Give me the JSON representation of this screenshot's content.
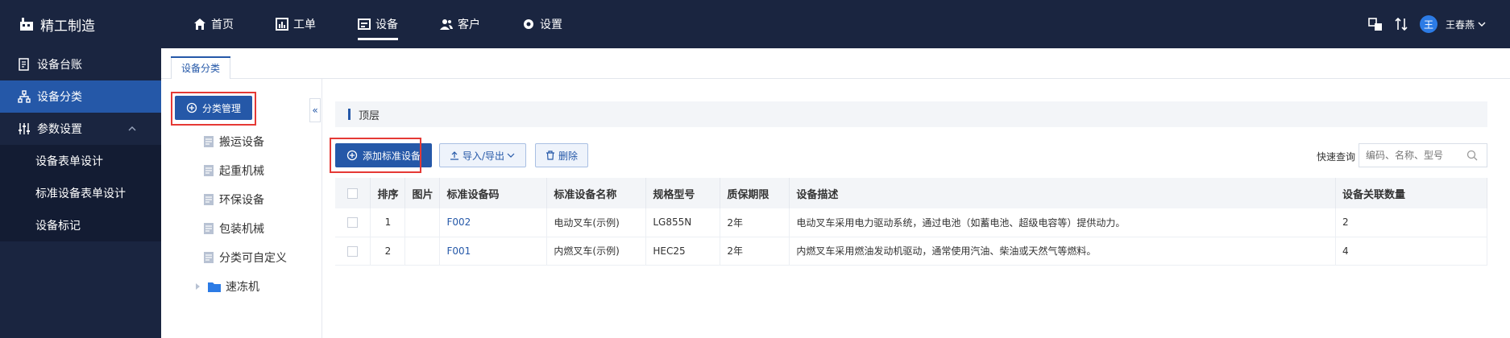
{
  "brand": "精工制造",
  "nav": [
    {
      "label": "首页",
      "icon": "home-icon"
    },
    {
      "label": "工单",
      "icon": "chart-icon"
    },
    {
      "label": "设备",
      "icon": "equipment-icon",
      "active": true
    },
    {
      "label": "客户",
      "icon": "users-icon"
    },
    {
      "label": "设置",
      "icon": "gear-icon"
    }
  ],
  "user": {
    "avatar": "王",
    "name": "王春燕"
  },
  "sidebar": {
    "items": [
      {
        "label": "设备台账"
      },
      {
        "label": "设备分类"
      },
      {
        "label": "参数设置"
      }
    ],
    "subitems": [
      {
        "label": "设备表单设计"
      },
      {
        "label": "标准设备表单设计"
      },
      {
        "label": "设备标记"
      }
    ]
  },
  "tab": "设备分类",
  "left": {
    "manage_button": "分类管理",
    "collapse_glyph": "«",
    "tree": [
      {
        "label": "搬运设备"
      },
      {
        "label": "起重机械"
      },
      {
        "label": "环保设备"
      },
      {
        "label": "包装机械"
      },
      {
        "label": "分类可自定义"
      }
    ],
    "folder": "速冻机"
  },
  "level_label": "顶层",
  "toolbar": {
    "add": "添加标准设备",
    "import_export": "导入/导出",
    "delete": "删除",
    "quick_label": "快速查询",
    "search_placeholder": "编码、名称、型号"
  },
  "table": {
    "headers": {
      "seq": "排序",
      "img": "图片",
      "code": "标准设备码",
      "name": "标准设备名称",
      "model": "规格型号",
      "warranty": "质保期限",
      "desc": "设备描述",
      "count": "设备关联数量"
    },
    "rows": [
      {
        "seq": "1",
        "code": "F002",
        "name": "电动叉车(示例)",
        "model": "LG855N",
        "warranty": "2年",
        "desc": "电动叉车采用电力驱动系统，通过电池（如蓄电池、超级电容等）提供动力。",
        "count": "2"
      },
      {
        "seq": "2",
        "code": "F001",
        "name": "内燃叉车(示例)",
        "model": "HEC25",
        "warranty": "2年",
        "desc": "内燃叉车采用燃油发动机驱动，通常使用汽油、柴油或天然气等燃料。",
        "count": "4"
      }
    ]
  },
  "colors": {
    "brand_navy": "#1a2540",
    "accent_blue": "#2558a8",
    "highlight_red": "#e53935"
  }
}
